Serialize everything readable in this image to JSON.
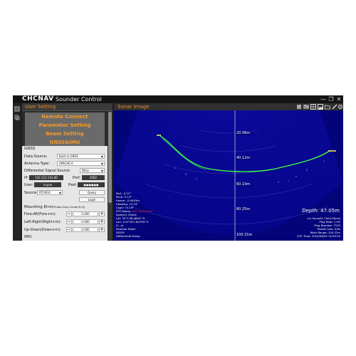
{
  "app": {
    "logo": "CHCNAV",
    "title": "Sounder Control",
    "window_buttons": [
      "—",
      "❐",
      "✕"
    ]
  },
  "left_panel": {
    "title": "User Setting",
    "menu": [
      "Remote Connect",
      "Parameter Setting",
      "Beam Setting",
      "GNSS&IMU"
    ],
    "gnss": {
      "section": "GNSS",
      "data_source_label": "Data Source:",
      "data_source_value": "Built-in GNSS",
      "antenna_label": "Antenna Type:",
      "antenna_value": "APACHE 6",
      "diff_label": "Differential Signal Source:",
      "diff_value": "Ntrip",
      "ip_label": "IP:",
      "ip_value": "122.112.141.80",
      "port_label": "Port:",
      "port_value": "5002",
      "user_label": "User:",
      "user_value": "xuyue",
      "pwd_label": "Pwd:",
      "pwd_value": "●●●●●●",
      "source_label": "Source:",
      "source_value": "RTCM32",
      "query_button": "Query",
      "login_button": "Login",
      "mount_label": "Mounting Error",
      "mount_sub": "(Probe Array Center(0,0))",
      "rows": [
        {
          "label": "Fore-Aft(Fore+m):",
          "value": "0.000"
        },
        {
          "label": "Left-Right(Right+m):",
          "value": "0.000"
        },
        {
          "label": "Up-Down(Down+m):",
          "value": "0.000"
        }
      ],
      "imu_label": "IMU"
    }
  },
  "sonar": {
    "title": "Sonar Image",
    "toolbar_icons": [
      "pause-icon",
      "sliders-icon",
      "grid-icon",
      "image-icon",
      "folder-icon",
      "pen-icon",
      "settings-icon"
    ],
    "depth_labels": [
      "20.06m",
      "40.12m",
      "60.19m",
      "80.25m",
      "100.31m"
    ],
    "info_left": [
      {
        "text": "Roll: -0.21°",
        "alert": false
      },
      {
        "text": "Pitch: 5.13°",
        "alert": false
      },
      {
        "text": "Heave: -0.0043m",
        "alert": false
      },
      {
        "text": "Heading: 74.19°",
        "alert": false
      },
      {
        "text": "Cog0: 74.19°",
        "alert": false
      },
      {
        "text": "FPS Status: ",
        "alert": false
      },
      {
        "text": "Speed:2.35kt/s",
        "alert": false
      },
      {
        "text": "Lat: 33°1'48.4804\" N",
        "alert": false
      },
      {
        "text": "Lon: 119°30'2.84799\" E",
        "alert": false
      },
      {
        "text": "H: -m",
        "alert": false
      },
      {
        "text": "Solution State:",
        "alert": false
      },
      {
        "text": "HDOP:",
        "alert": false
      },
      {
        "text": "Differential Delay:",
        "alert": false
      }
    ],
    "fps_alert": "Not Connected",
    "depth_readout": "Depth: 47.05m",
    "info_right": [
      "cur SoundV: 1504.50m/s",
      "Ping Rate: 1 HZ",
      "Ping Number: 7125",
      "Packet Loss: 0/0s",
      "Work Range: 100.31m",
      "UTC Time: 2024/08/05 14:55:25"
    ],
    "colors": {
      "background": "#04047a",
      "seabed": "#3cff3c",
      "gate": "#ffee55"
    }
  }
}
